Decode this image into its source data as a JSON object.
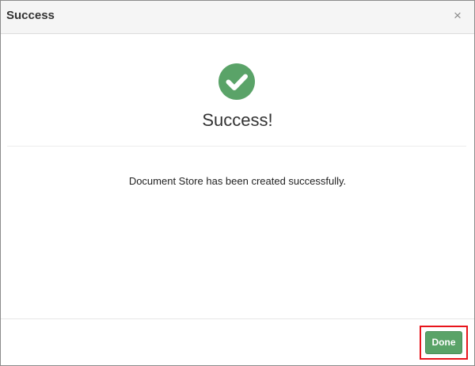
{
  "dialog": {
    "title": "Success",
    "close_label": "×",
    "heading": "Success!",
    "message": "Document Store has been created successfully.",
    "done_label": "Done"
  },
  "icons": {
    "status": "check-circle-icon",
    "close": "close-icon"
  },
  "colors": {
    "success_green": "#5aa368",
    "highlight_red": "#e8141b",
    "header_bg": "#f5f5f5"
  }
}
